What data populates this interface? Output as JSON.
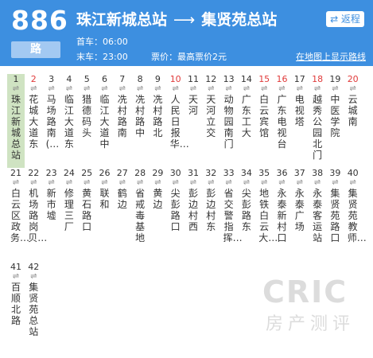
{
  "route": {
    "number": "886",
    "tag": "路",
    "from": "珠江新城总站",
    "arrow": "⟶",
    "to": "集贤苑总站",
    "return_label": "⇄ 返程",
    "first_bus": "首车：06:00",
    "last_bus": "末车：23:00",
    "fare": "票价：最高票价2元",
    "map_link": "在地图上显示路线"
  },
  "colors": {
    "header": "#3d8fe0",
    "tag": "#a3c9f2",
    "highlight": "#cfe3c2",
    "number_red": "#e03a3a",
    "text": "#333333"
  },
  "stops": [
    {
      "num": "1",
      "name": "珠江新城总站",
      "red": false,
      "highlight": true
    },
    {
      "num": "2",
      "name": "花城大道东",
      "red": true
    },
    {
      "num": "3",
      "name": "马场路南(…",
      "red": false
    },
    {
      "num": "4",
      "name": "临江大道东",
      "red": false
    },
    {
      "num": "5",
      "name": "猎德码头",
      "red": false
    },
    {
      "num": "6",
      "name": "临江大道中",
      "red": false
    },
    {
      "num": "7",
      "name": "冼村路南",
      "red": false
    },
    {
      "num": "8",
      "name": "冼村路中",
      "red": false
    },
    {
      "num": "9",
      "name": "冼村路北",
      "red": false
    },
    {
      "num": "10",
      "name": "人民日报华…",
      "red": true
    },
    {
      "num": "11",
      "name": "天河",
      "red": false
    },
    {
      "num": "12",
      "name": "天河立交",
      "red": false
    },
    {
      "num": "13",
      "name": "动物园南门",
      "red": false
    },
    {
      "num": "14",
      "name": "广东工大",
      "red": false
    },
    {
      "num": "15",
      "name": "白云宾馆",
      "red": true
    },
    {
      "num": "16",
      "name": "广东电视台",
      "red": true
    },
    {
      "num": "17",
      "name": "电视塔",
      "red": false
    },
    {
      "num": "18",
      "name": "越秀公园北门",
      "red": true
    },
    {
      "num": "19",
      "name": "中医学院",
      "red": false
    },
    {
      "num": "20",
      "name": "云城南",
      "red": true
    },
    {
      "num": "21",
      "name": "白云区政务…",
      "red": false
    },
    {
      "num": "22",
      "name": "机场路岗贝…",
      "red": false
    },
    {
      "num": "23",
      "name": "新市墟",
      "red": false
    },
    {
      "num": "24",
      "name": "修理三厂",
      "red": false
    },
    {
      "num": "25",
      "name": "黄石路口",
      "red": false
    },
    {
      "num": "26",
      "name": "联和",
      "red": false
    },
    {
      "num": "27",
      "name": "鹤边",
      "red": false
    },
    {
      "num": "28",
      "name": "省戒毒基地",
      "red": false
    },
    {
      "num": "29",
      "name": "黄边",
      "red": false
    },
    {
      "num": "30",
      "name": "尖彭路口",
      "red": false
    },
    {
      "num": "31",
      "name": "彭边村西",
      "red": false
    },
    {
      "num": "32",
      "name": "彭边村东",
      "red": false
    },
    {
      "num": "33",
      "name": "省交警指挥…",
      "red": false
    },
    {
      "num": "34",
      "name": "尖彭路东",
      "red": false
    },
    {
      "num": "35",
      "name": "地铁白云大…",
      "red": false
    },
    {
      "num": "36",
      "name": "永泰新村口",
      "red": false
    },
    {
      "num": "37",
      "name": "永泰广场",
      "red": false
    },
    {
      "num": "38",
      "name": "永泰客运站",
      "red": false
    },
    {
      "num": "39",
      "name": "集贤苑路口",
      "red": false
    },
    {
      "num": "40",
      "name": "集贤苑教师…",
      "red": false
    },
    {
      "num": "41",
      "name": "百顺北路",
      "red": false
    },
    {
      "num": "42",
      "name": "集贤苑总站",
      "red": false
    }
  ],
  "dir_glyph": "⇌",
  "watermark": {
    "logo": "CRIC",
    "text": "房产测评"
  }
}
